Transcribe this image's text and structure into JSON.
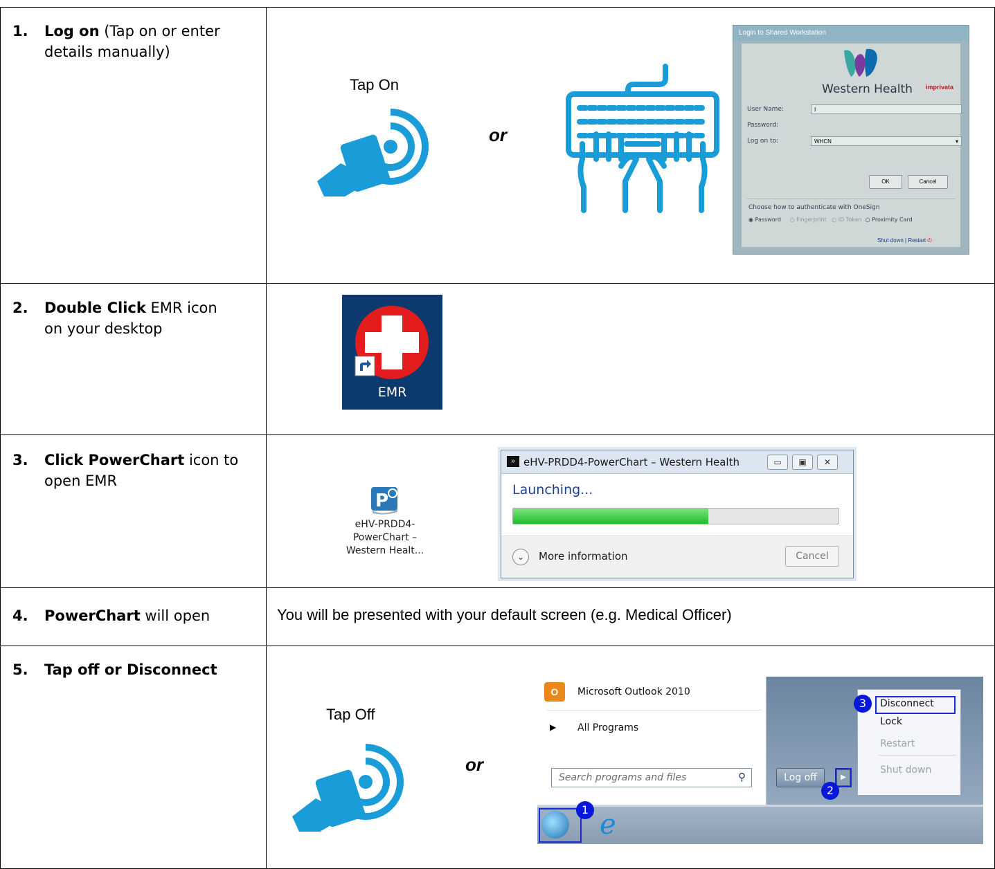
{
  "steps": [
    {
      "num": "1.",
      "bold": "Log on",
      "rest": " (Tap on or enter",
      "cont": "details manually)"
    },
    {
      "num": "2.",
      "bold": "Double Click",
      "rest": " EMR icon",
      "cont": "on your desktop"
    },
    {
      "num": "3.",
      "bold": "Click PowerChart",
      "rest": " icon to",
      "cont": "open EMR"
    },
    {
      "num": "4.",
      "bold": "PowerChart",
      "rest": " will open",
      "cont": ""
    },
    {
      "num": "5.",
      "bold": "Tap off or Disconnect",
      "rest": "",
      "cont": ""
    }
  ],
  "row1": {
    "tap_on": "Tap On",
    "or": "or",
    "login": {
      "title": "Login to Shared Workstation",
      "brand": "Western Health",
      "vendor": "imprivata",
      "user_label": "User Name:",
      "user_value": "I",
      "password_label": "Password:",
      "logon_label": "Log on to:",
      "logon_value": "WHCN",
      "ok": "OK",
      "cancel": "Cancel",
      "auth_heading": "Choose how to authenticate with OneSign",
      "auth_options": [
        "Password",
        "Fingerprint",
        "ID Token",
        "Proximity Card"
      ],
      "shutdown": "Shut down",
      "separator": "|",
      "restart": "Restart"
    }
  },
  "row2": {
    "emr_label": "EMR"
  },
  "row3": {
    "icon_label": [
      "eHV-PRDD4-",
      "PowerChart –",
      "Western Healt..."
    ],
    "dialog_title": "eHV-PRDD4-PowerChart – Western Health",
    "status": "Launching...",
    "progress": 0.6,
    "more_info": "More information",
    "cancel": "Cancel"
  },
  "row4": {
    "text": "You will be presented with your default screen (e.g. Medical Officer)"
  },
  "row5": {
    "tap_off": "Tap Off",
    "or": "or",
    "menu": {
      "outlook": "Microsoft Outlook 2010",
      "all_programs": "All Programs",
      "search_placeholder": "Search programs and files",
      "log_off": "Log off",
      "disconnect": "Disconnect",
      "lock": "Lock",
      "restart": "Restart",
      "shut_down": "Shut down",
      "badges": [
        "1",
        "2",
        "3"
      ]
    }
  }
}
